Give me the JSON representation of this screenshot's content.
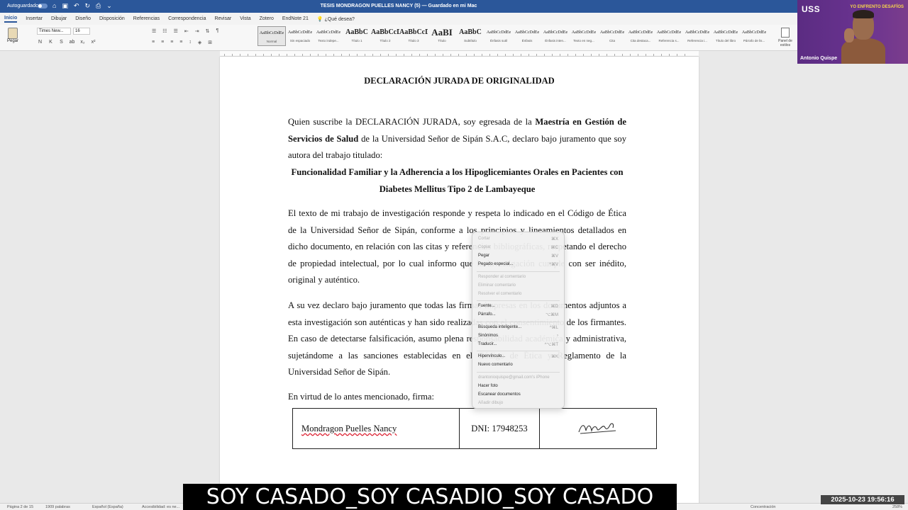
{
  "titlebar": {
    "autosave_label": "Autoguardado",
    "doc_title": "TESIS MONDRAGON PUELLES NANCY (5) — Guardado en mi Mac"
  },
  "tabs": [
    "Inicio",
    "Insertar",
    "Dibujar",
    "Diseño",
    "Disposición",
    "Referencias",
    "Correspondencia",
    "Revisar",
    "Vista",
    "Zotero",
    "EndNote 21"
  ],
  "tell_me": "¿Qué desea?",
  "ribbon": {
    "paste_label": "Pegar",
    "font_name": "Times New...",
    "font_size": "16",
    "format_buttons": [
      "N",
      "K",
      "S",
      "ab",
      "x₂",
      "x²"
    ],
    "para_row1": [
      "☰",
      "☷",
      "☰",
      "⇤",
      "⇥",
      "⇅",
      "¶"
    ],
    "para_row2": [
      "≡",
      "≡",
      "≡",
      "≡",
      "↕",
      "◈",
      "⊞"
    ],
    "styles": [
      {
        "sample": "AaBbCcDdEe",
        "name": "Normal",
        "kind": "small"
      },
      {
        "sample": "AaBbCcDdEe",
        "name": "Sin espaciado",
        "kind": "small"
      },
      {
        "sample": "AaBbCcDdEe",
        "name": "Texto indepe...",
        "kind": "small"
      },
      {
        "sample": "AaBbC",
        "name": "Título 1",
        "kind": "big"
      },
      {
        "sample": "AaBbCcD",
        "name": "Título 2",
        "kind": "big"
      },
      {
        "sample": "AaBbCcDdI",
        "name": "Título 3",
        "kind": "medium"
      },
      {
        "sample": "AaBI",
        "name": "Título",
        "kind": "bigger"
      },
      {
        "sample": "AaBbC",
        "name": "Subtítulo",
        "kind": "big"
      },
      {
        "sample": "AaBbCcDdEe",
        "name": "Énfasis sutil",
        "kind": "small"
      },
      {
        "sample": "AaBbCcDdEe",
        "name": "Énfasis",
        "kind": "small"
      },
      {
        "sample": "AaBbCcDdEe",
        "name": "Énfasis inten...",
        "kind": "small"
      },
      {
        "sample": "AaBbCcDdEe",
        "name": "Texto en neg...",
        "kind": "small"
      },
      {
        "sample": "AaBbCcDdEe",
        "name": "Cita",
        "kind": "small"
      },
      {
        "sample": "AaBbCcDdEe",
        "name": "Cita destaca...",
        "kind": "small"
      },
      {
        "sample": "AaBbCcDdEe",
        "name": "Referencia s...",
        "kind": "small"
      },
      {
        "sample": "AaBbCcDdEe",
        "name": "Referencia i...",
        "kind": "small"
      },
      {
        "sample": "AaBbCcDdEe",
        "name": "Título del libro",
        "kind": "small"
      },
      {
        "sample": "AaBbCcDdEe",
        "name": "Párrafo de lis...",
        "kind": "small"
      }
    ],
    "styles_pane_label": "Panel de estilos"
  },
  "document": {
    "heading": "DECLARACIÓN JURADA DE ORIGINALIDAD",
    "p1_a": "Quien suscribe la DECLARACIÓN JURADA, soy egresada de la ",
    "p1_b": "Maestría en Gestión de Servicios de Salud",
    "p1_c": " de la Universidad Señor de Sipán S.A.C, declaro bajo juramento que soy autora del trabajo titulado:",
    "thesis_title": "Funcionalidad Familiar y la Adherencia a los Hipoglicemiantes Orales en Pacientes con Diabetes Mellitus Tipo 2 de Lambayeque",
    "p2": "El texto de mi trabajo de investigación responde y respeta lo indicado en el Código de Ética de la Universidad Señor de Sipán, conforme a los principios y lineamientos detallados en dicho documento, en relación con las citas y referencias bibliográficas, respetando el derecho de propiedad intelectual, por lo cual informo que la investigación cumple con ser inédito, original y auténtico.",
    "p3": "A su vez declaro bajo juramento que todas las firmas impresas en los documentos adjuntos a esta investigación son auténticas y han sido realizadas con el consentimiento de los firmantes. En caso de detectarse falsificación, asumo plena responsabilidad académica y administrativa, sujetándome a las sanciones establecidas en el Código de Ética y Reglamento de la Universidad Señor de Sipán.",
    "p4": "En virtud de lo antes mencionado, firma:",
    "sig_name": "Mondragon Puelles Nancy",
    "sig_dni": "DNI: 17948253"
  },
  "context_menu": {
    "items": [
      {
        "label": "Cortar",
        "shortcut": "⌘X",
        "enabled": false
      },
      {
        "label": "Copiar",
        "shortcut": "⌘C",
        "enabled": false
      },
      {
        "label": "Pegar",
        "shortcut": "⌘V",
        "enabled": true
      },
      {
        "label": "Pegado especial...",
        "shortcut": "^⌘V",
        "enabled": true
      },
      {
        "label": "Responder al comentario",
        "shortcut": "",
        "enabled": false
      },
      {
        "label": "Eliminar comentario",
        "shortcut": "",
        "enabled": false
      },
      {
        "label": "Resolver el comentario",
        "shortcut": "",
        "enabled": false
      },
      {
        "label": "Fuente...",
        "shortcut": "⌘D",
        "enabled": true
      },
      {
        "label": "Párrafo...",
        "shortcut": "⌥⌘M",
        "enabled": true
      },
      {
        "label": "Búsqueda inteligente...",
        "shortcut": "^⌘L",
        "enabled": true
      },
      {
        "label": "Sinónimos",
        "shortcut": "›",
        "enabled": true
      },
      {
        "label": "Traducir...",
        "shortcut": "^⌥⌘T",
        "enabled": true
      },
      {
        "label": "Hipervínculo...",
        "shortcut": "⌘K",
        "enabled": true
      },
      {
        "label": "Nuevo comentario",
        "shortcut": "",
        "enabled": true
      },
      {
        "label": "drantonioquispe@gmail.com's iPhone",
        "shortcut": "",
        "enabled": false
      },
      {
        "label": "Hacer foto",
        "shortcut": "",
        "enabled": true
      },
      {
        "label": "Escanear documentos",
        "shortcut": "",
        "enabled": true
      },
      {
        "label": "Añadir dibujo",
        "shortcut": "",
        "enabled": false
      }
    ]
  },
  "statusbar": {
    "page": "Página 2 de 15",
    "words": "1909 palabras",
    "language": "Español (España)",
    "accessibility": "Accesibilidad: es ne...",
    "focus": "Concentración",
    "zoom": "258%"
  },
  "video": {
    "logo": "USS",
    "slogan": "YO ENFRENTO DESAFÍOS",
    "presenter": "Antonio Quispe"
  },
  "caption": "SOY CASADO_SOY CASADIO_SOY CASADO",
  "timestamp": "2025-10-23  19:56:16"
}
